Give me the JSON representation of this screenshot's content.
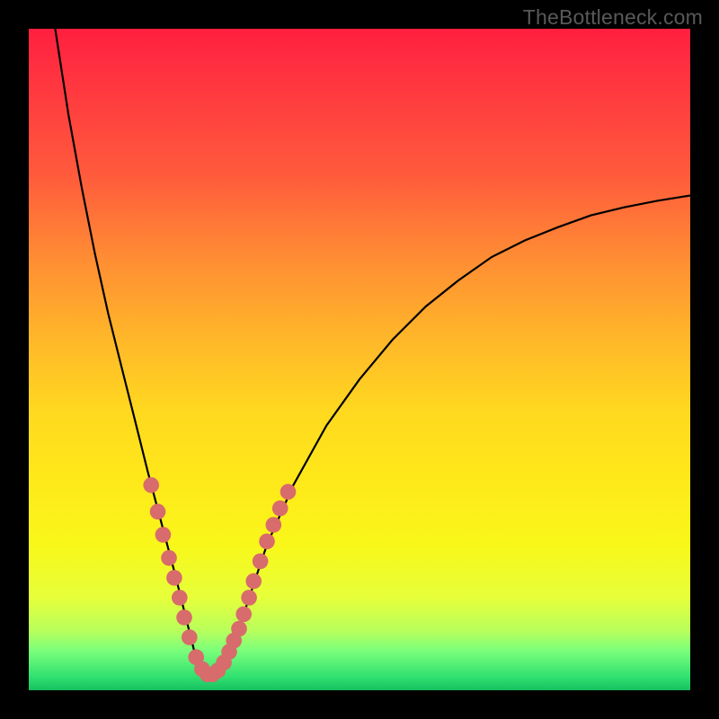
{
  "watermark": "TheBottleneck.com",
  "chart_data": {
    "type": "line",
    "title": "",
    "xlabel": "",
    "ylabel": "",
    "xlim": [
      0,
      100
    ],
    "ylim": [
      0,
      100
    ],
    "curve": {
      "description": "V-shaped bottleneck curve with minimum near x≈27, rising steeply on the left toward 100 and asymptotically toward ~74 on the right",
      "points": [
        {
          "x": 4.0,
          "y": 100.0
        },
        {
          "x": 6.0,
          "y": 87.0
        },
        {
          "x": 8.0,
          "y": 76.0
        },
        {
          "x": 10.0,
          "y": 66.0
        },
        {
          "x": 12.0,
          "y": 57.0
        },
        {
          "x": 14.0,
          "y": 49.0
        },
        {
          "x": 16.0,
          "y": 41.0
        },
        {
          "x": 18.0,
          "y": 33.0
        },
        {
          "x": 20.0,
          "y": 25.5
        },
        {
          "x": 22.0,
          "y": 18.0
        },
        {
          "x": 24.0,
          "y": 10.0
        },
        {
          "x": 25.0,
          "y": 6.0
        },
        {
          "x": 26.0,
          "y": 3.0
        },
        {
          "x": 27.0,
          "y": 2.0
        },
        {
          "x": 28.0,
          "y": 2.0
        },
        {
          "x": 29.0,
          "y": 3.2
        },
        {
          "x": 30.0,
          "y": 5.0
        },
        {
          "x": 32.0,
          "y": 10.0
        },
        {
          "x": 34.0,
          "y": 16.0
        },
        {
          "x": 36.0,
          "y": 22.0
        },
        {
          "x": 40.0,
          "y": 31.0
        },
        {
          "x": 45.0,
          "y": 40.0
        },
        {
          "x": 50.0,
          "y": 47.0
        },
        {
          "x": 55.0,
          "y": 53.0
        },
        {
          "x": 60.0,
          "y": 58.0
        },
        {
          "x": 65.0,
          "y": 62.0
        },
        {
          "x": 70.0,
          "y": 65.5
        },
        {
          "x": 75.0,
          "y": 68.0
        },
        {
          "x": 80.0,
          "y": 70.0
        },
        {
          "x": 85.0,
          "y": 71.8
        },
        {
          "x": 90.0,
          "y": 73.0
        },
        {
          "x": 95.0,
          "y": 74.0
        },
        {
          "x": 100.0,
          "y": 74.8
        }
      ]
    },
    "markers": {
      "color": "#d86b6b",
      "radius": 1.2,
      "points": [
        {
          "x": 18.5,
          "y": 31.0
        },
        {
          "x": 19.5,
          "y": 27.0
        },
        {
          "x": 20.3,
          "y": 23.5
        },
        {
          "x": 21.2,
          "y": 20.0
        },
        {
          "x": 22.0,
          "y": 17.0
        },
        {
          "x": 22.8,
          "y": 14.0
        },
        {
          "x": 23.5,
          "y": 11.0
        },
        {
          "x": 24.3,
          "y": 8.0
        },
        {
          "x": 25.3,
          "y": 5.0
        },
        {
          "x": 26.2,
          "y": 3.2
        },
        {
          "x": 27.0,
          "y": 2.4
        },
        {
          "x": 27.8,
          "y": 2.4
        },
        {
          "x": 28.6,
          "y": 3.0
        },
        {
          "x": 29.5,
          "y": 4.2
        },
        {
          "x": 30.3,
          "y": 5.8
        },
        {
          "x": 31.0,
          "y": 7.5
        },
        {
          "x": 31.8,
          "y": 9.3
        },
        {
          "x": 32.5,
          "y": 11.5
        },
        {
          "x": 33.3,
          "y": 14.0
        },
        {
          "x": 34.0,
          "y": 16.5
        },
        {
          "x": 35.0,
          "y": 19.5
        },
        {
          "x": 36.0,
          "y": 22.5
        },
        {
          "x": 37.0,
          "y": 25.0
        },
        {
          "x": 38.0,
          "y": 27.5
        },
        {
          "x": 39.2,
          "y": 30.0
        }
      ]
    }
  }
}
